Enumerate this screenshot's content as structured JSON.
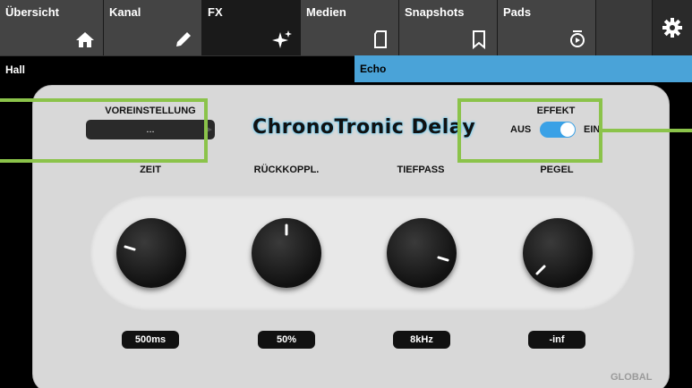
{
  "tabs": [
    {
      "label": "Übersicht",
      "icon": "home-icon"
    },
    {
      "label": "Kanal",
      "icon": "pencil-icon"
    },
    {
      "label": "FX",
      "icon": "sparkle-icon"
    },
    {
      "label": "Medien",
      "icon": "sd-card-icon"
    },
    {
      "label": "Snapshots",
      "icon": "bookmark-icon"
    },
    {
      "label": "Pads",
      "icon": "pad-icon"
    },
    {
      "label": "",
      "icon": "gear-icon"
    }
  ],
  "subtabs": {
    "hall": "Hall",
    "echo": "Echo"
  },
  "panel": {
    "preset_label": "VOREINSTELLUNG",
    "preset_value": "...",
    "title": "ChronoTronic Delay",
    "effect_label": "EFFEKT",
    "effect_off": "AUS",
    "effect_on": "EIN",
    "effect_state": "on",
    "params": [
      {
        "label": "ZEIT",
        "value": "500ms"
      },
      {
        "label": "RÜCKKOPPL.",
        "value": "50%"
      },
      {
        "label": "TIEFPASS",
        "value": "8kHz"
      },
      {
        "label": "PEGEL",
        "value": "-inf"
      }
    ],
    "global": "GLOBAL"
  },
  "colors": {
    "accent": "#4aa3d8",
    "callout": "#8bc34a",
    "toggle": "#3aa1e6"
  }
}
